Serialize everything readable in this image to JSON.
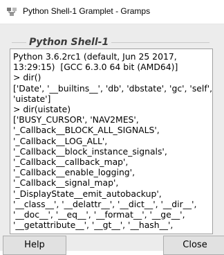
{
  "window": {
    "title": "Python Shell-1 Gramplet - Gramps",
    "icon": "gramps-app-icon"
  },
  "pane": {
    "title": "Python Shell-1"
  },
  "console": {
    "output": "Python 3.6.2rc1 (default, Jun 25 2017,\n13:29:15)  [GCC 6.3.0 64 bit (AMD64)]\n> dir()\n['Date', '__builtins__', 'db', 'dbstate', 'gc', 'self',\n'uistate']\n> dir(uistate)\n['BUSY_CURSOR', 'NAV2MES',\n'_Callback__BLOCK_ALL_SIGNALS',\n'_Callback__LOG_ALL',\n'_Callback__block_instance_signals',\n'_Callback__callback_map',\n'_Callback__enable_logging',\n'_Callback__signal_map',\n'_DisplayState__emit_autobackup',\n'__class__', '__delattr__', '__dict__', '__dir__',\n'__doc__', '__eq__', '__format__', '__ge__',\n'__getattribute__', '__gt__', '__hash__',"
  },
  "buttons": {
    "help_label": "Help",
    "close_label": "Close"
  }
}
